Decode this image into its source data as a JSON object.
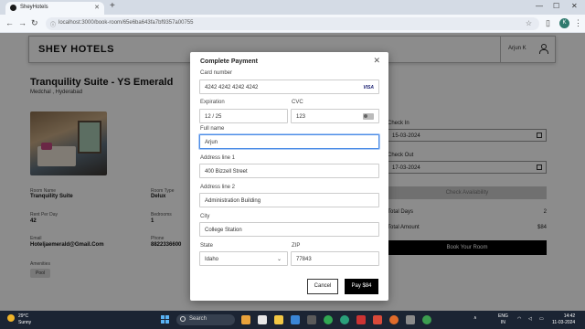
{
  "browser": {
    "tab_title": "SheyHotels",
    "url": "localhost:3000/book-room/65e6ba643fa7bf9357a00755",
    "profile_initial": "K"
  },
  "header": {
    "logo": "SHEY HOTELS",
    "user": "Arjun K"
  },
  "room": {
    "title": "Tranquility Suite - YS Emerald",
    "location": "Medchal , Hyderabad",
    "details": {
      "room_name_label": "Room Name",
      "room_name": "Tranquility Suite",
      "room_type_label": "Room Type",
      "room_type": "Delux",
      "rent_label": "Rent Per Day",
      "rent": "42",
      "bedrooms_label": "Bedrooms",
      "bedrooms": "1",
      "email_label": "Email",
      "email": "Hoteljaemerald@Gmail.Com",
      "phone_label": "Phone",
      "phone": "8822336600",
      "amenities_label": "Amenities",
      "amenity": "Pool"
    }
  },
  "booking": {
    "check_in_label": "Check In",
    "check_in": "15-03-2024",
    "check_out_label": "Check Out",
    "check_out": "17-03-2024",
    "check_availability": "Check Availability",
    "total_days_label": "Total Days",
    "total_days": "2",
    "total_amount_label": "Total Amount",
    "total_amount": "$84",
    "book_button": "Book Your Room"
  },
  "modal": {
    "title": "Complete Payment",
    "card_number_label": "Card number",
    "card_number": "4242 4242 4242 4242",
    "card_brand": "VISA",
    "expiration_label": "Expiration",
    "expiration": "12 / 25",
    "cvc_label": "CVC",
    "cvc": "123",
    "full_name_label": "Full name",
    "full_name": "Arjun",
    "address1_label": "Address line 1",
    "address1": "400 Bizzell Street",
    "address2_label": "Address line 2",
    "address2": "Administration Building",
    "city_label": "City",
    "city": "College Station",
    "state_label": "State",
    "state": "Idaho",
    "zip_label": "ZIP",
    "zip": "77843",
    "cancel_button": "Cancel",
    "pay_button": "Pay $84"
  },
  "taskbar": {
    "weather_temp": "29°C",
    "weather_desc": "Sunny",
    "search_placeholder": "Search",
    "lang": "ENG",
    "region": "IN",
    "time": "14:42",
    "date": "11-03-2024"
  }
}
